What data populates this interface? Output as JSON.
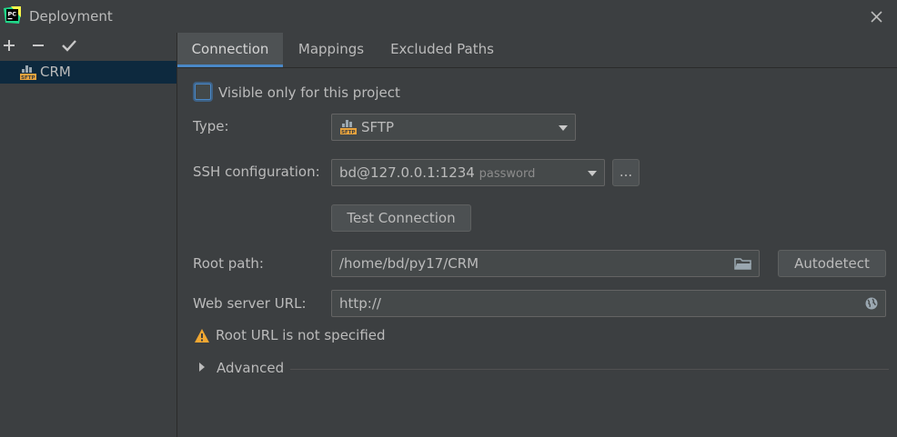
{
  "window": {
    "title": "Deployment"
  },
  "tree": {
    "items": [
      {
        "label": "CRM"
      }
    ]
  },
  "tabs": [
    {
      "label": "Connection"
    },
    {
      "label": "Mappings"
    },
    {
      "label": "Excluded Paths"
    }
  ],
  "connection": {
    "visible_only_label": "Visible only for this project",
    "type_label": "Type:",
    "type_value": "SFTP",
    "ssh_label": "SSH configuration:",
    "ssh_value": "bd@127.0.0.1:1234",
    "ssh_hint": "password",
    "ssh_more": "...",
    "test_connection": "Test Connection",
    "root_path_label": "Root path:",
    "root_path_value": "/home/bd/py17/CRM",
    "autodetect": "Autodetect",
    "web_url_label": "Web server URL:",
    "web_url_value": "http://",
    "warning": "Root URL is not specified",
    "advanced": "Advanced"
  },
  "icons": [
    "pycharm-logo",
    "close-icon",
    "add-icon",
    "remove-icon",
    "check-icon",
    "sftp-icon",
    "folder-icon",
    "globe-icon",
    "warning-icon",
    "expand-arrow-icon"
  ],
  "colors": {
    "background": "#3c3f41",
    "selection": "#0d293e",
    "accent": "#4a88c7",
    "warning": "#f0a732"
  }
}
